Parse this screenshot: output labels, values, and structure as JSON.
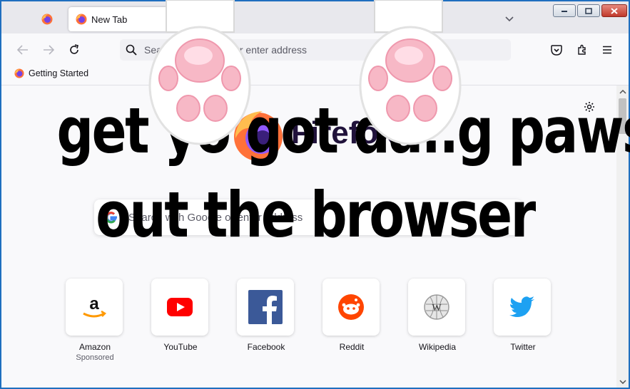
{
  "tabs": {
    "active_title": "New Tab"
  },
  "urlbar": {
    "placeholder": "Search with Google or enter address"
  },
  "bookmarks": [
    {
      "label": "Getting Started"
    }
  ],
  "newtab": {
    "wordmark": "Firefox",
    "search_placeholder": "Search with Google or enter address",
    "top_sites": [
      {
        "label": "Amazon",
        "sub": "Sponsored",
        "icon": "amazon-icon"
      },
      {
        "label": "YouTube",
        "sub": "",
        "icon": "youtube-icon"
      },
      {
        "label": "Facebook",
        "sub": "",
        "icon": "facebook-icon"
      },
      {
        "label": "Reddit",
        "sub": "",
        "icon": "reddit-icon"
      },
      {
        "label": "Wikipedia",
        "sub": "",
        "icon": "wikipedia-icon"
      },
      {
        "label": "Twitter",
        "sub": "",
        "icon": "twitter-icon"
      }
    ]
  },
  "meme": {
    "line1": "get yo got da..g paws",
    "line2": "out the browser"
  }
}
